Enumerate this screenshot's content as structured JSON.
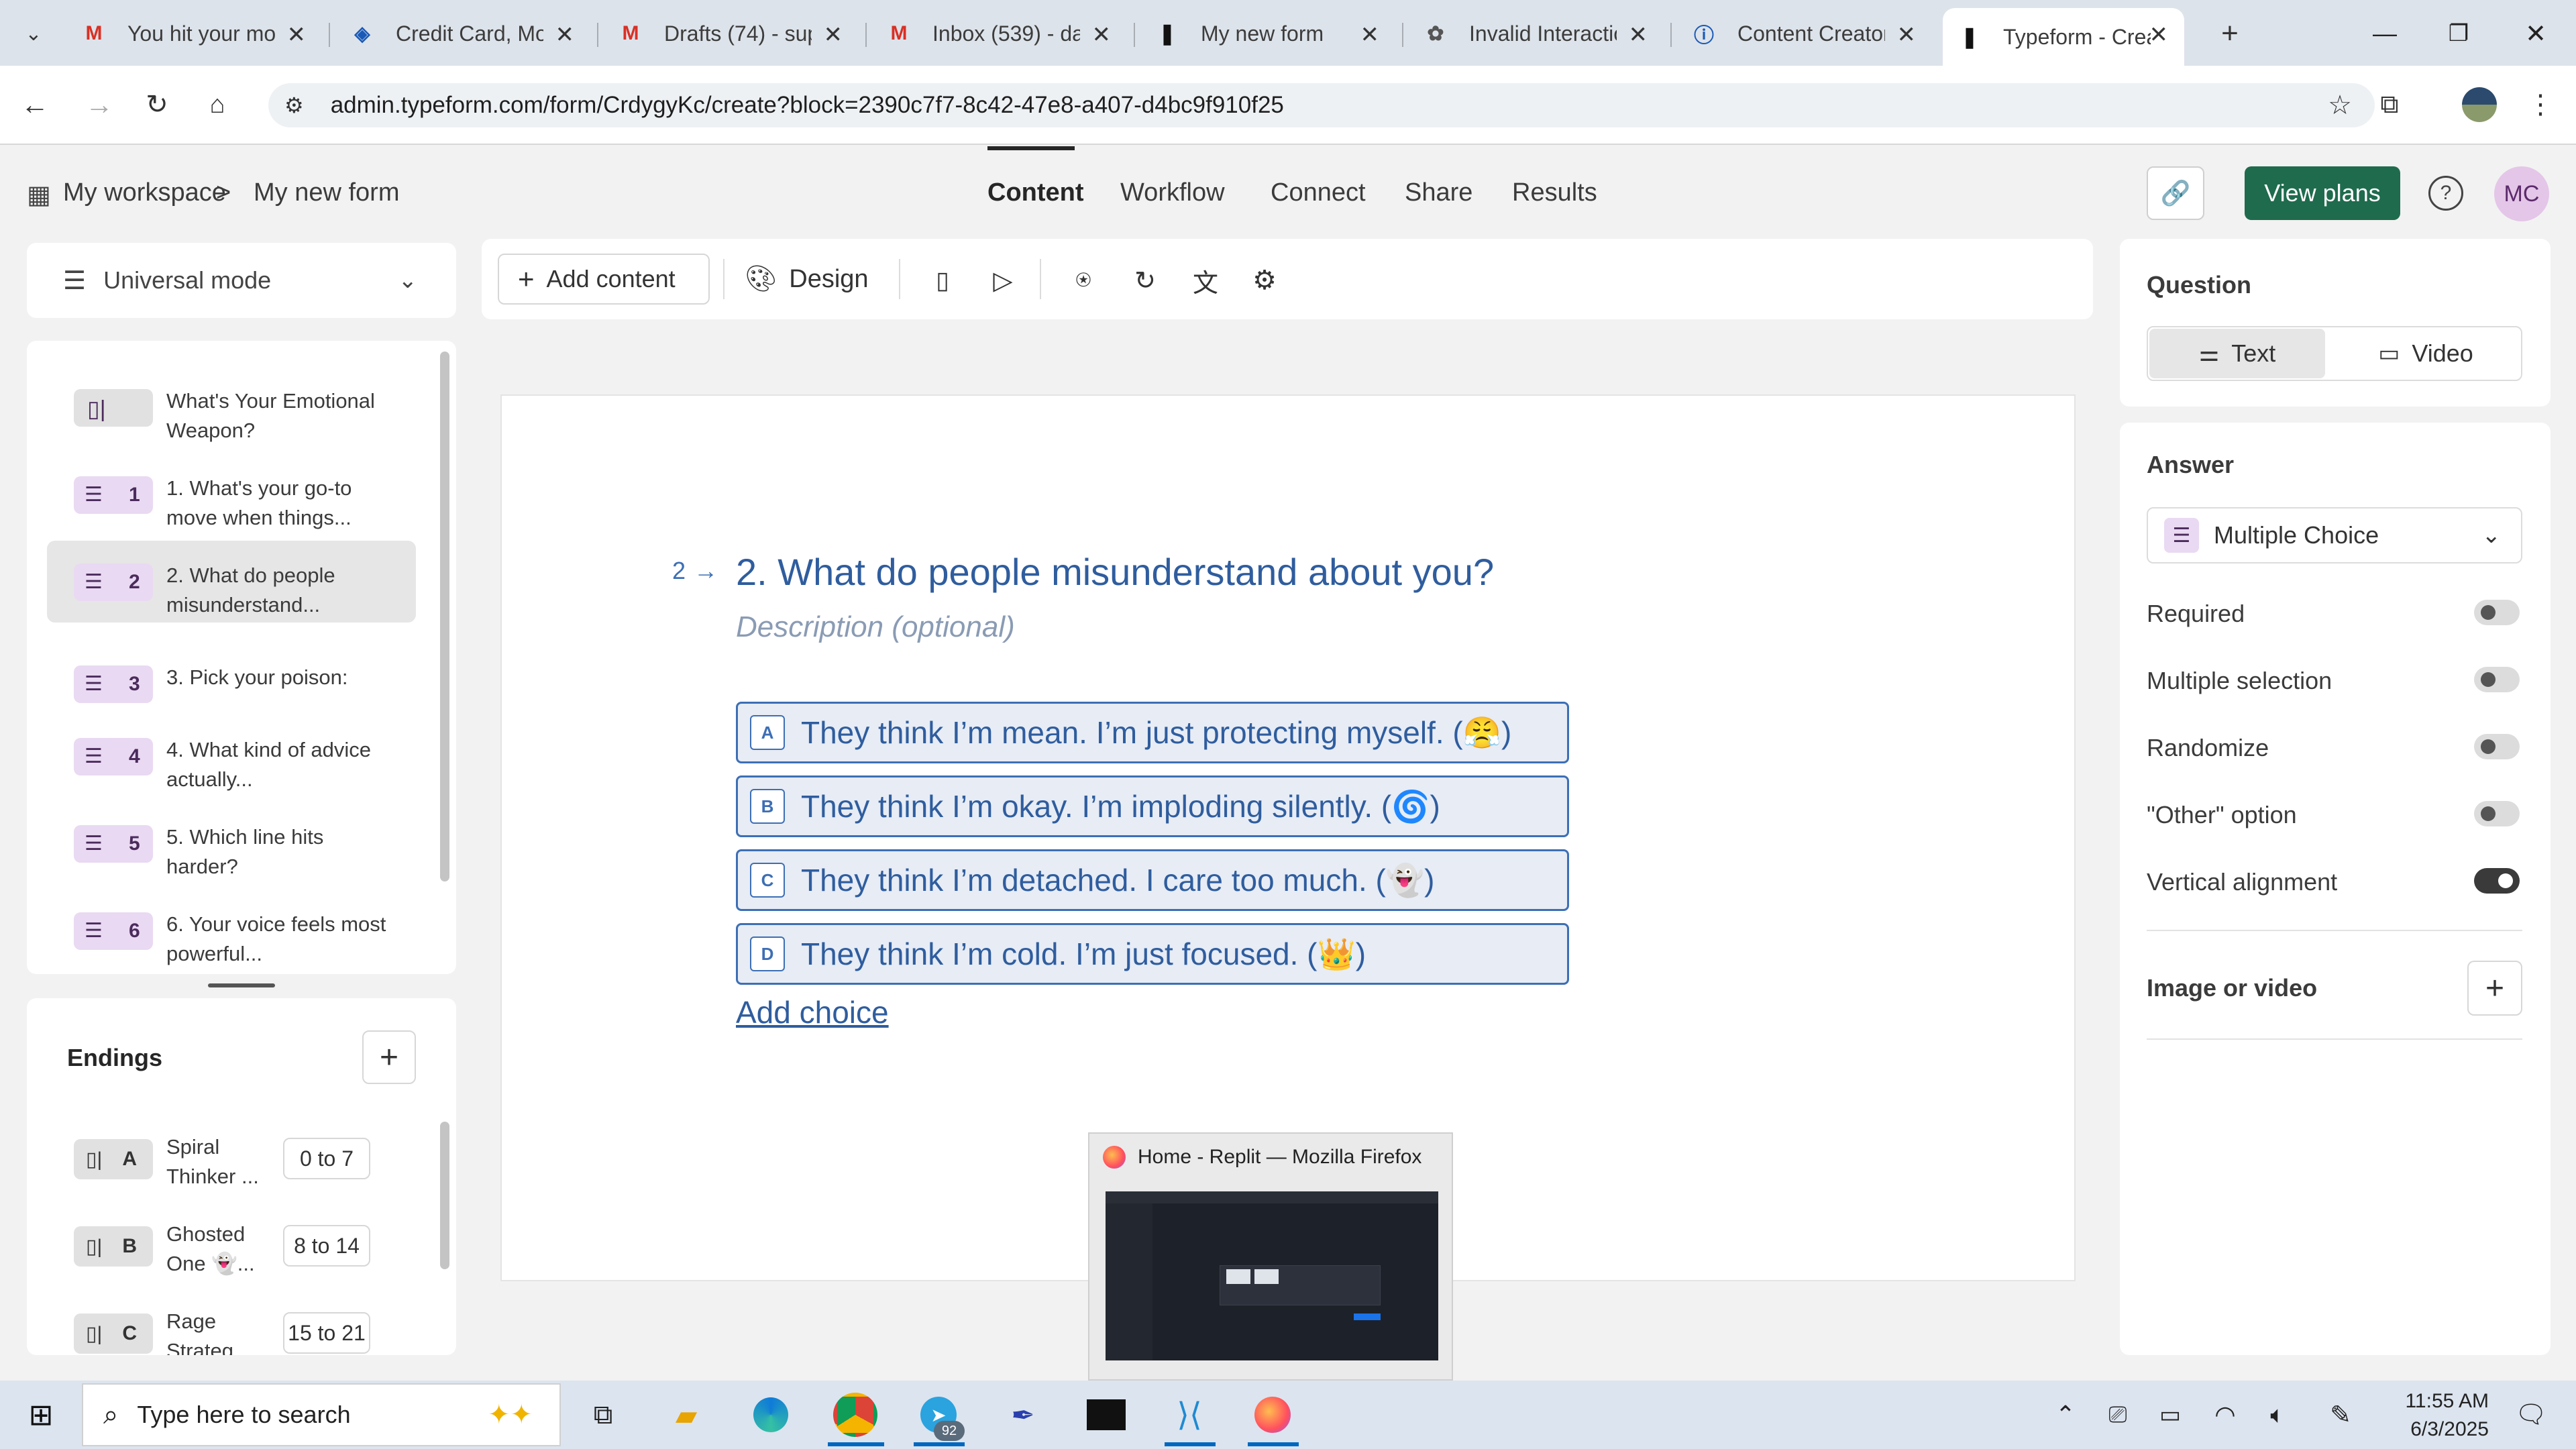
{
  "browser": {
    "tabs": [
      {
        "title": "You hit your mo",
        "icon": "gmail-icon"
      },
      {
        "title": "Credit Card, Mo",
        "icon": "chase-icon"
      },
      {
        "title": "Drafts (74) - sup",
        "icon": "gmail-icon"
      },
      {
        "title": "Inbox (539) - dat",
        "icon": "gmail-icon"
      },
      {
        "title": "My new form",
        "icon": "typeform-icon"
      },
      {
        "title": "Invalid Interactio",
        "icon": "openai-icon"
      },
      {
        "title": "Content Creator",
        "icon": "info-icon"
      },
      {
        "title": "Typeform - Creat",
        "icon": "typeform-icon"
      }
    ],
    "url": "admin.typeform.com/form/CrdygyKc/create?block=2390c7f7-8c42-47e8-a407-d4bc9f910f25"
  },
  "header": {
    "breadcrumb_workspace": "My workspace",
    "breadcrumb_sep": ">",
    "form_name": "My new form",
    "nav": [
      "Content",
      "Workflow",
      "Connect",
      "Share",
      "Results"
    ],
    "view_plans": "View plans",
    "avatar": "MC"
  },
  "toolbar": {
    "mode": "Universal mode",
    "add_content": "Add content",
    "design": "Design"
  },
  "questions": [
    {
      "num": "",
      "label": "What's Your Emotional Weapon?",
      "type": "statement"
    },
    {
      "num": "1",
      "label": "1. What's your go-to move when things...",
      "type": "choice"
    },
    {
      "num": "2",
      "label": "2. What do people misunderstand...",
      "type": "choice"
    },
    {
      "num": "3",
      "label": "3. Pick your poison:",
      "type": "choice"
    },
    {
      "num": "4",
      "label": "4. What kind of advice actually...",
      "type": "choice"
    },
    {
      "num": "5",
      "label": "5. Which line hits harder?",
      "type": "choice"
    },
    {
      "num": "6",
      "label": "6. Your voice feels most powerful...",
      "type": "choice"
    }
  ],
  "endings": {
    "title": "Endings",
    "items": [
      {
        "key": "A",
        "label": "Spiral Thinker ...",
        "range": "0 to 7"
      },
      {
        "key": "B",
        "label": "Ghosted One 👻...",
        "range": "8 to 14"
      },
      {
        "key": "C",
        "label": "Rage Strateg...",
        "range": "15 to 21"
      }
    ]
  },
  "editor": {
    "question_number": "2",
    "question_title": "2. What do people misunderstand about you?",
    "description_placeholder": "Description (optional)",
    "choices": [
      {
        "key": "A",
        "text": "They think I’m mean. I’m just protecting myself. (😤)"
      },
      {
        "key": "B",
        "text": "They think I’m okay. I’m imploding silently. (🌀)"
      },
      {
        "key": "C",
        "text": "They think I’m detached. I care too much. (👻)"
      },
      {
        "key": "D",
        "text": "They think I’m cold. I’m just focused. (👑)"
      }
    ],
    "add_choice": "Add choice"
  },
  "right_panel": {
    "question_title": "Question",
    "text_tab": "Text",
    "video_tab": "Video",
    "answer_title": "Answer",
    "answer_type": "Multiple Choice",
    "settings": [
      {
        "label": "Required",
        "on": false
      },
      {
        "label": "Multiple selection",
        "on": false
      },
      {
        "label": "Randomize",
        "on": false
      },
      {
        "label": "\"Other\" option",
        "on": false
      },
      {
        "label": "Vertical alignment",
        "on": true
      }
    ],
    "image_or_video": "Image or video"
  },
  "tooltip": {
    "title": "Home - Replit — Mozilla Firefox"
  },
  "taskbar": {
    "search_placeholder": "Type here to search",
    "badge": "92",
    "time": "11:55 AM",
    "date": "6/3/2025"
  },
  "colors": {
    "accent_green": "#1f6b4e",
    "choice_blue": "#3d6fb5",
    "badge_purple": "#e9d9f2"
  }
}
